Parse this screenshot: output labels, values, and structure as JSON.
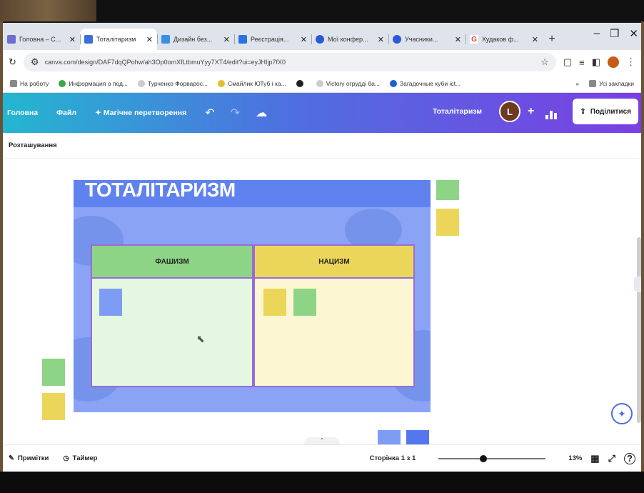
{
  "browser": {
    "tabs": [
      {
        "label": "Головна – C...",
        "color": "#6a6fd0"
      },
      {
        "label": "Тоталітаризм",
        "color": "#3a6fd8"
      },
      {
        "label": "Дизайн без...",
        "color": "#3a8ee8"
      },
      {
        "label": "Реєстрація...",
        "color": "#2c72e0"
      },
      {
        "label": "Мої конфер...",
        "color": "#2a59d8"
      },
      {
        "label": "Учасники...",
        "color": "#2a59d8"
      },
      {
        "label": "Худаков ф...",
        "color": "#e0453a"
      }
    ],
    "url": "canva.com/design/DAF7dqQPohw/ah3Op0omXfLtbmuYyy7XT4/edit?ui=eyJHIjp7fX0",
    "bookmarks": [
      {
        "label": "На роботу",
        "color": "#888888"
      },
      {
        "label": "Информация о под...",
        "color": "#3aa84a"
      },
      {
        "label": "Турченко Форварос...",
        "color": "#cccccc"
      },
      {
        "label": "Смайлик ЮТуб і ка...",
        "color": "#e0c030"
      },
      {
        "label": "",
        "color": "#222222"
      },
      {
        "label": "Victory огрудді ба...",
        "color": "#cccccc"
      },
      {
        "label": "Загадочные куби ict...",
        "color": "#1a5fd0"
      }
    ],
    "bookmarks_all": "Усі закладки"
  },
  "canva": {
    "menu": {
      "home": "Головна",
      "file": "Файл",
      "magic": "✦ Магічне перетворення"
    },
    "doc_title": "Тоталітаризм",
    "user_initial": "L",
    "share": "Поділитися",
    "position": "Розташування",
    "slide": {
      "title": "ТОТАЛІТАРИЗМ",
      "col1": "ФАШИЗМ",
      "col2": "НАЦИЗМ"
    },
    "footer": {
      "notes": "Примітки",
      "timer": "Таймер",
      "page": "Сторінка 1 з 1",
      "zoom": "13%"
    }
  },
  "colors": {
    "green_note": "#8ed486",
    "yellow_note": "#ecd65a",
    "blue_note": "#7f9cf5",
    "dark_blue_note": "#5577ee"
  }
}
